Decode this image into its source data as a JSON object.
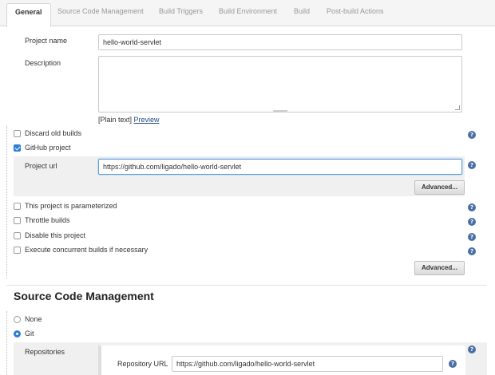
{
  "tabs": [
    {
      "label": "General",
      "active": true
    },
    {
      "label": "Source Code Management"
    },
    {
      "label": "Build Triggers"
    },
    {
      "label": "Build Environment"
    },
    {
      "label": "Build"
    },
    {
      "label": "Post-build Actions"
    }
  ],
  "general": {
    "project_name_label": "Project name",
    "project_name_value": "hello-world-servlet",
    "description_label": "Description",
    "description_value": "",
    "plain_text": "[Plain text]",
    "preview_link": "Preview"
  },
  "options": {
    "discard_old_builds": {
      "label": "Discard old builds",
      "checked": false
    },
    "github_project": {
      "label": "GitHub project",
      "checked": true
    },
    "project_url_label": "Project url",
    "project_url_value": "https://github.com/ligado/hello-world-servlet",
    "advanced_label": "Advanced...",
    "parameterized": {
      "label": "This project is parameterized",
      "checked": false
    },
    "throttle": {
      "label": "Throttle builds",
      "checked": false
    },
    "disable": {
      "label": "Disable this project",
      "checked": false
    },
    "concurrent": {
      "label": "Execute concurrent builds if necessary",
      "checked": false
    },
    "advanced2_label": "Advanced..."
  },
  "scm": {
    "title": "Source Code Management",
    "none_label": "None",
    "git_label": "Git",
    "selected": "Git",
    "repositories_label": "Repositories",
    "repository_url_label": "Repository URL",
    "repository_url_value": "https://github.com/ligado/hello-world-servlet"
  },
  "help_glyph": "?",
  "icons": {
    "help": "help-icon",
    "checkbox": "checkbox-icon",
    "radio": "radio-icon"
  },
  "colors": {
    "accent": "#2f7fd6",
    "help": "#4a6fa5",
    "focus": "#5a9fdc"
  }
}
